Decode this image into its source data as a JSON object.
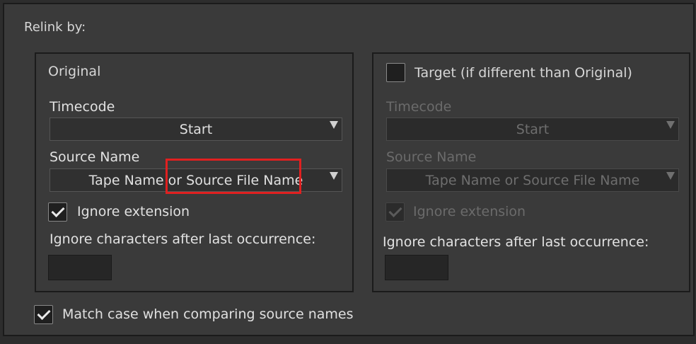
{
  "relink_by_label": "Relink by:",
  "original": {
    "title": "Original",
    "timecode_label": "Timecode",
    "timecode_value": "Start",
    "source_name_label": "Source Name",
    "source_name_value": "Tape Name or Source File Name",
    "ignore_extension_label": "Ignore extension",
    "ignore_extension_checked": true,
    "ignore_chars_label": "Ignore characters after last occurrence:",
    "ignore_chars_value": ""
  },
  "target": {
    "title": "Target (if different than Original)",
    "enabled_checked": false,
    "timecode_label": "Timecode",
    "timecode_value": "Start",
    "source_name_label": "Source Name",
    "source_name_value": "Tape Name or Source File Name",
    "ignore_extension_label": "Ignore extension",
    "ignore_extension_checked": true,
    "ignore_chars_label": "Ignore characters after last occurrence:",
    "ignore_chars_value": ""
  },
  "match_case_label": "Match case when comparing source names",
  "match_case_checked": true,
  "colors": {
    "panel_bg": "#3a3a3a",
    "border": "#1b1b1b",
    "highlight": "#e02020"
  }
}
